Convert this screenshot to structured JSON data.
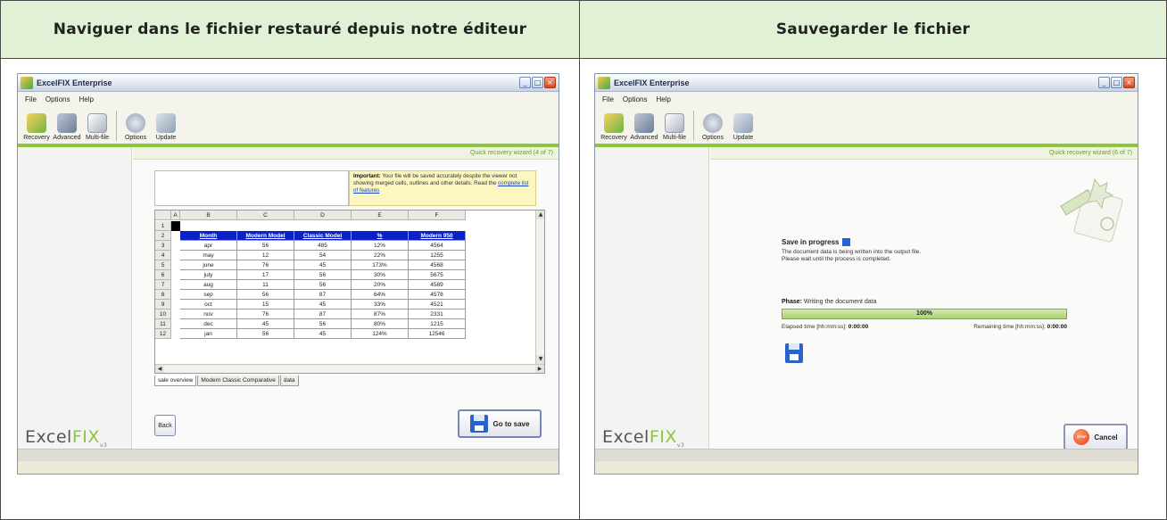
{
  "headers": {
    "left": "Naviguer dans le fichier restauré depuis notre éditeur",
    "right": "Sauvegarder le fichier"
  },
  "app": {
    "title": "ExcelFIX Enterprise",
    "menu": [
      "File",
      "Options",
      "Help"
    ],
    "toolbar": [
      "Recovery",
      "Advanced",
      "Multi-file",
      "Options",
      "Update"
    ],
    "logo": {
      "name_a": "Excel",
      "name_b": "FIX",
      "version": "v3"
    }
  },
  "left_panel": {
    "wizard_step": "Quick recovery wizard (4 of 7)",
    "important": {
      "label": "Important:",
      "text": "Your file will be saved accurately despite the viewer not showing merged cells, outlines and other details. Read the",
      "link": "complete list of features"
    },
    "columns": [
      "A",
      "B",
      "C",
      "D",
      "E",
      "F"
    ],
    "rows": [
      "1",
      "2",
      "3",
      "4",
      "5",
      "6",
      "7",
      "8",
      "9",
      "10",
      "11",
      "12"
    ],
    "table_headers": [
      "Month",
      "Modern Model",
      "Classic Model",
      "%",
      "Modern 950"
    ],
    "table_rows": [
      [
        "apr",
        "56",
        "485",
        "12%",
        "4564"
      ],
      [
        "may",
        "12",
        "54",
        "22%",
        "1255"
      ],
      [
        "june",
        "76",
        "45",
        "173%",
        "4568"
      ],
      [
        "july",
        "17",
        "56",
        "30%",
        "5675"
      ],
      [
        "aug",
        "11",
        "56",
        "20%",
        "4589"
      ],
      [
        "sep",
        "56",
        "87",
        "64%",
        "4578"
      ],
      [
        "oct",
        "15",
        "45",
        "33%",
        "4521"
      ],
      [
        "nov",
        "76",
        "87",
        "87%",
        "2331"
      ],
      [
        "dec",
        "45",
        "56",
        "80%",
        "1215"
      ],
      [
        "jan",
        "56",
        "45",
        "124%",
        "12546"
      ]
    ],
    "sheet_tabs": [
      "sale overview",
      "Modern Classic Comparative",
      "data"
    ],
    "back_label": "Back",
    "go_save_label": "Go to save"
  },
  "right_panel": {
    "wizard_step": "Quick recovery wizard (6 of 7)",
    "save_title": "Save in progress",
    "save_line1": "The document data is being written into the output file.",
    "save_line2": "Please wait until the process is completed.",
    "phase_label": "Phase:",
    "phase_value": "Writing the document data",
    "progress_text": "100%",
    "progress_value": 1.0,
    "elapsed_label": "Elapsed time [hh:mm:ss]:",
    "elapsed_value": "0:00:00",
    "remaining_label": "Remaining time [hh:mm:ss]:",
    "remaining_value": "0:00:00",
    "stop_icon_text": "STOP",
    "cancel_label": "Cancel"
  },
  "colors": {
    "header_bg": "#e2f0d5",
    "accent_green": "#8cc63f",
    "sheet_header_blue": "#0c22c9"
  }
}
